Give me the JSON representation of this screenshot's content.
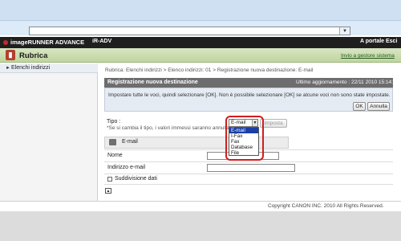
{
  "header": {
    "brand": "imageRUNNER ADVANCE",
    "device": "iR-ADV",
    "portal_link": "A portale",
    "exit_link": "Esci"
  },
  "app": {
    "title": "Rubrica",
    "send_to_admin_link": "Invio a gestore sistema"
  },
  "sidebar": {
    "items": [
      {
        "label": "Elenchi indirizzi"
      }
    ]
  },
  "main": {
    "breadcrumb": "Rubrica: Elenchi indirizzi > Elenco indirizzi: 01 > Registrazione nuova destinazione: E-mail",
    "panel_title": "Registrazione nuova destinazione",
    "last_update": "Ultimo aggiornamento : 22/11 2010 15:14:08",
    "info_message": "Impostare tutte le voci, quindi selezionare [OK]. Non è possibile selezionare [OK] se alcune voci non sono state impostate.",
    "ok_label": "OK",
    "cancel_label": "Annulla",
    "type_label": "Tipo :",
    "type_note": "*Se si cambia il tipo, i valori immessi saranno annullati.",
    "type_selected": "E-mail",
    "type_options": [
      "E-mail",
      "I-Fax",
      "Fax",
      "Database",
      "File"
    ],
    "set_button": "Imposta",
    "section_label": "E-mail",
    "name_label": "Nome",
    "name_value": "",
    "email_label": "Indirizzo e-mail",
    "email_value": "",
    "subdivision_label": "Suddivisione dati",
    "subdivision_checked": false
  },
  "footer": {
    "copyright": "Copyright CANON INC. 2010 All Rights Reserved."
  },
  "colors": {
    "header_bg": "#1f1f1f",
    "appbar_green": "#bfd59f",
    "panel_header": "#6d6d6d",
    "selection_blue": "#1b3fa8",
    "highlight_red": "#d11d1d"
  }
}
